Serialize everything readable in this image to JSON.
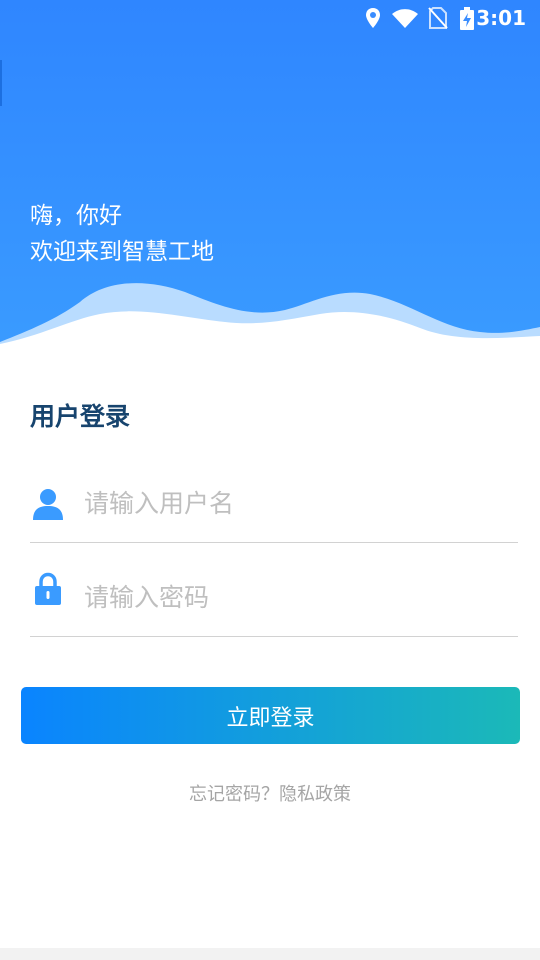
{
  "status_bar": {
    "time": "3:01",
    "icons": [
      "location-icon",
      "wifi-icon",
      "no-sim-icon",
      "battery-charging-icon"
    ]
  },
  "header": {
    "greeting_line1": "嗨，你好",
    "greeting_line2": "欢迎来到智慧工地"
  },
  "login": {
    "title": "用户登录",
    "username_placeholder": "请输入用户名",
    "password_placeholder": "请输入密码",
    "username_icon": "user-icon",
    "password_icon": "lock-icon",
    "submit_label": "立即登录",
    "forgot_label": "忘记密码？",
    "privacy_label": "隐私政策"
  },
  "colors": {
    "header_top": "#2f86ff",
    "header_bottom": "#3a9bff",
    "title": "#17446e",
    "button_start": "#0a84ff",
    "button_end": "#1bb9b8",
    "icon": "#3a9bff"
  }
}
